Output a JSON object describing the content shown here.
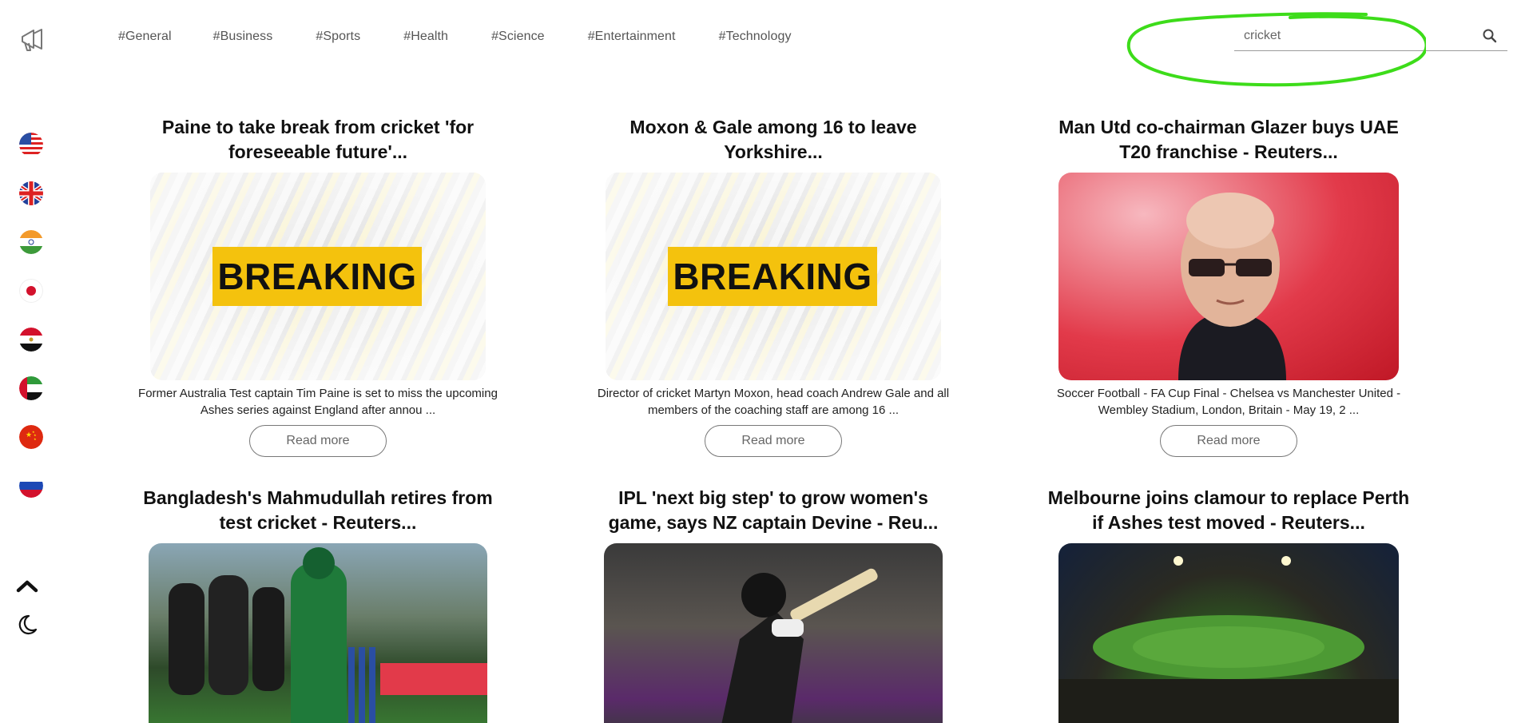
{
  "nav": {
    "categories": [
      "#General",
      "#Business",
      "#Sports",
      "#Health",
      "#Science",
      "#Entertainment",
      "#Technology"
    ]
  },
  "search": {
    "value": "cricket"
  },
  "sidebar": {
    "flags": [
      "us-flag-icon",
      "uk-flag-icon",
      "india-flag-icon",
      "japan-flag-icon",
      "egypt-flag-icon",
      "uae-flag-icon",
      "china-flag-icon",
      "russia-flag-icon"
    ]
  },
  "articles": [
    {
      "title": "Paine to take break from cricket 'for foreseeable future'...",
      "image_text": "BREAKING",
      "description": "Former Australia Test captain Tim Paine is set to miss the upcoming Ashes series against England after annou ...",
      "button": "Read more"
    },
    {
      "title": "Moxon & Gale among 16 to leave Yorkshire...",
      "image_text": "BREAKING",
      "description": "Director of cricket Martyn Moxon, head coach Andrew Gale and all members of the coaching staff are among 16 ...",
      "button": "Read more"
    },
    {
      "title": "Man Utd co-chairman Glazer buys UAE T20 franchise - Reuters...",
      "description": "Soccer Football - FA Cup Final - Chelsea vs Manchester United - Wembley Stadium, London, Britain - May 19, 2 ...",
      "button": "Read more"
    },
    {
      "title": "Bangladesh's Mahmudullah retires from test cricket - Reuters..."
    },
    {
      "title": "IPL 'next big step' to grow women's game, says NZ captain Devine - Reu..."
    },
    {
      "title": "Melbourne joins clamour to replace Perth if Ashes test moved - Reuters..."
    }
  ],
  "colors": {
    "annotation": "#3ddc1a",
    "breaking_label": "#f4c20d"
  }
}
